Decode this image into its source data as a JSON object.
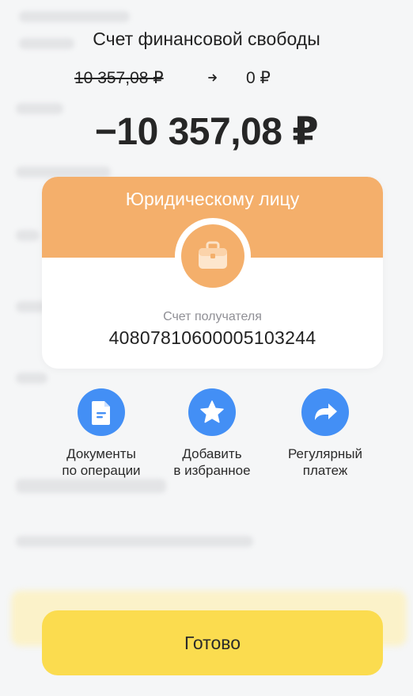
{
  "header": {
    "title": "Счет финансовой свободы",
    "balance_before": "10 357,08 ₽",
    "balance_after": "0 ₽"
  },
  "amount": "−10 357,08 ₽",
  "recipient_card": {
    "title": "Юридическому лицу",
    "icon": "briefcase-icon",
    "account_label": "Счет получателя",
    "account_number": "40807810600005103244",
    "accent_color": "#f4af6b"
  },
  "actions": [
    {
      "label_line1": "Документы",
      "label_line2": "по операции",
      "icon": "document-icon"
    },
    {
      "label_line1": "Добавить",
      "label_line2": "в избранное",
      "icon": "star-icon"
    },
    {
      "label_line1": "Регулярный",
      "label_line2": "платеж",
      "icon": "repeat-arrow-icon"
    }
  ],
  "action_color": "#438ff5",
  "done_button": {
    "label": "Готово",
    "color": "#fbdc4f"
  }
}
